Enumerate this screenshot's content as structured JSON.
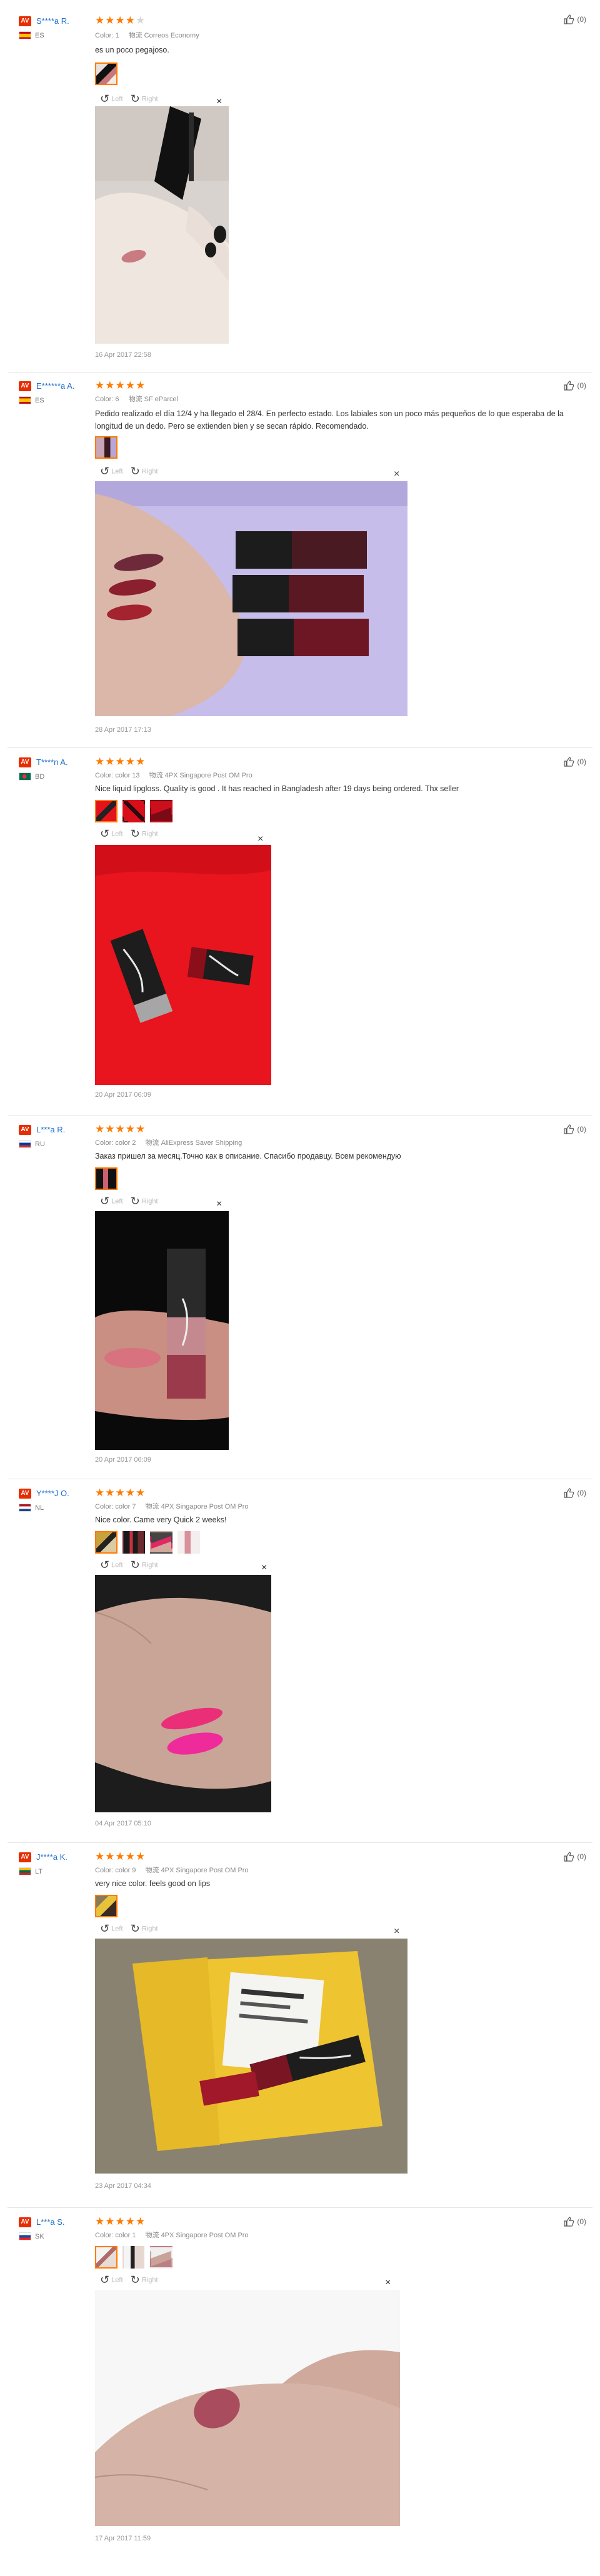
{
  "helpful_label": "(0)",
  "rotate_left_label": "Left",
  "rotate_right_label": "Right",
  "close_glyph": "×",
  "colors": {
    "star": "#ff7a00",
    "avatar": "#e62e04",
    "username": "#1f6fcf"
  },
  "reviews": [
    {
      "user": "S****a R.",
      "country": "ES",
      "stars": 4,
      "color_label": "Color:",
      "color": "1",
      "shipping_icon": "物流",
      "shipping": "Correos Economy",
      "text": "es un poco pegajoso.",
      "date": "16 Apr 2017 22:58"
    },
    {
      "user": "E******a A.",
      "country": "ES",
      "stars": 5,
      "color_label": "Color:",
      "color": "6",
      "shipping_icon": "物流",
      "shipping": "SF eParcel",
      "text": "Pedido realizado el día 12/4 y ha llegado el 28/4. En perfecto estado. Los labiales son un poco más pequeños de lo que esperaba de la longitud de un dedo. Pero se extienden bien y se secan rápido. Recomendado.",
      "date": "28 Apr 2017 17:13"
    },
    {
      "user": "T****n A.",
      "country": "BD",
      "stars": 5,
      "color_label": "Color:",
      "color": "color 13",
      "shipping_icon": "物流",
      "shipping": "4PX Singapore Post OM Pro",
      "text": "Nice liquid lipgloss. Quality is good . It has reached in Bangladesh after 19 days being ordered. Thx seller",
      "date": "20 Apr 2017 06:09"
    },
    {
      "user": "L***a R.",
      "country": "RU",
      "stars": 5,
      "color_label": "Color:",
      "color": "color 2",
      "shipping_icon": "物流",
      "shipping": "AliExpress Saver Shipping",
      "text": "Заказ пришел за месяц.Точно как в описание. Спасибо продавцу. Всем рекомендую",
      "date": "20 Apr 2017 06:09"
    },
    {
      "user": "Y****J O.",
      "country": "NL",
      "stars": 5,
      "color_label": "Color:",
      "color": "color 7",
      "shipping_icon": "物流",
      "shipping": "4PX Singapore Post OM Pro",
      "text": "Nice color. Came very Quick 2 weeks!",
      "date": "04 Apr 2017 05:10"
    },
    {
      "user": "J****a K.",
      "country": "LT",
      "stars": 5,
      "color_label": "Color:",
      "color": "color 9",
      "shipping_icon": "物流",
      "shipping": "4PX Singapore Post OM Pro",
      "text": "very nice color. feels good on lips",
      "date": "23 Apr 2017 04:34"
    },
    {
      "user": "L***a S.",
      "country": "SK",
      "stars": 5,
      "color_label": "Color:",
      "color": "color 1",
      "shipping_icon": "物流",
      "shipping": "4PX Singapore Post OM Pro",
      "text": "",
      "date": "17 Apr 2017 11:59"
    }
  ]
}
